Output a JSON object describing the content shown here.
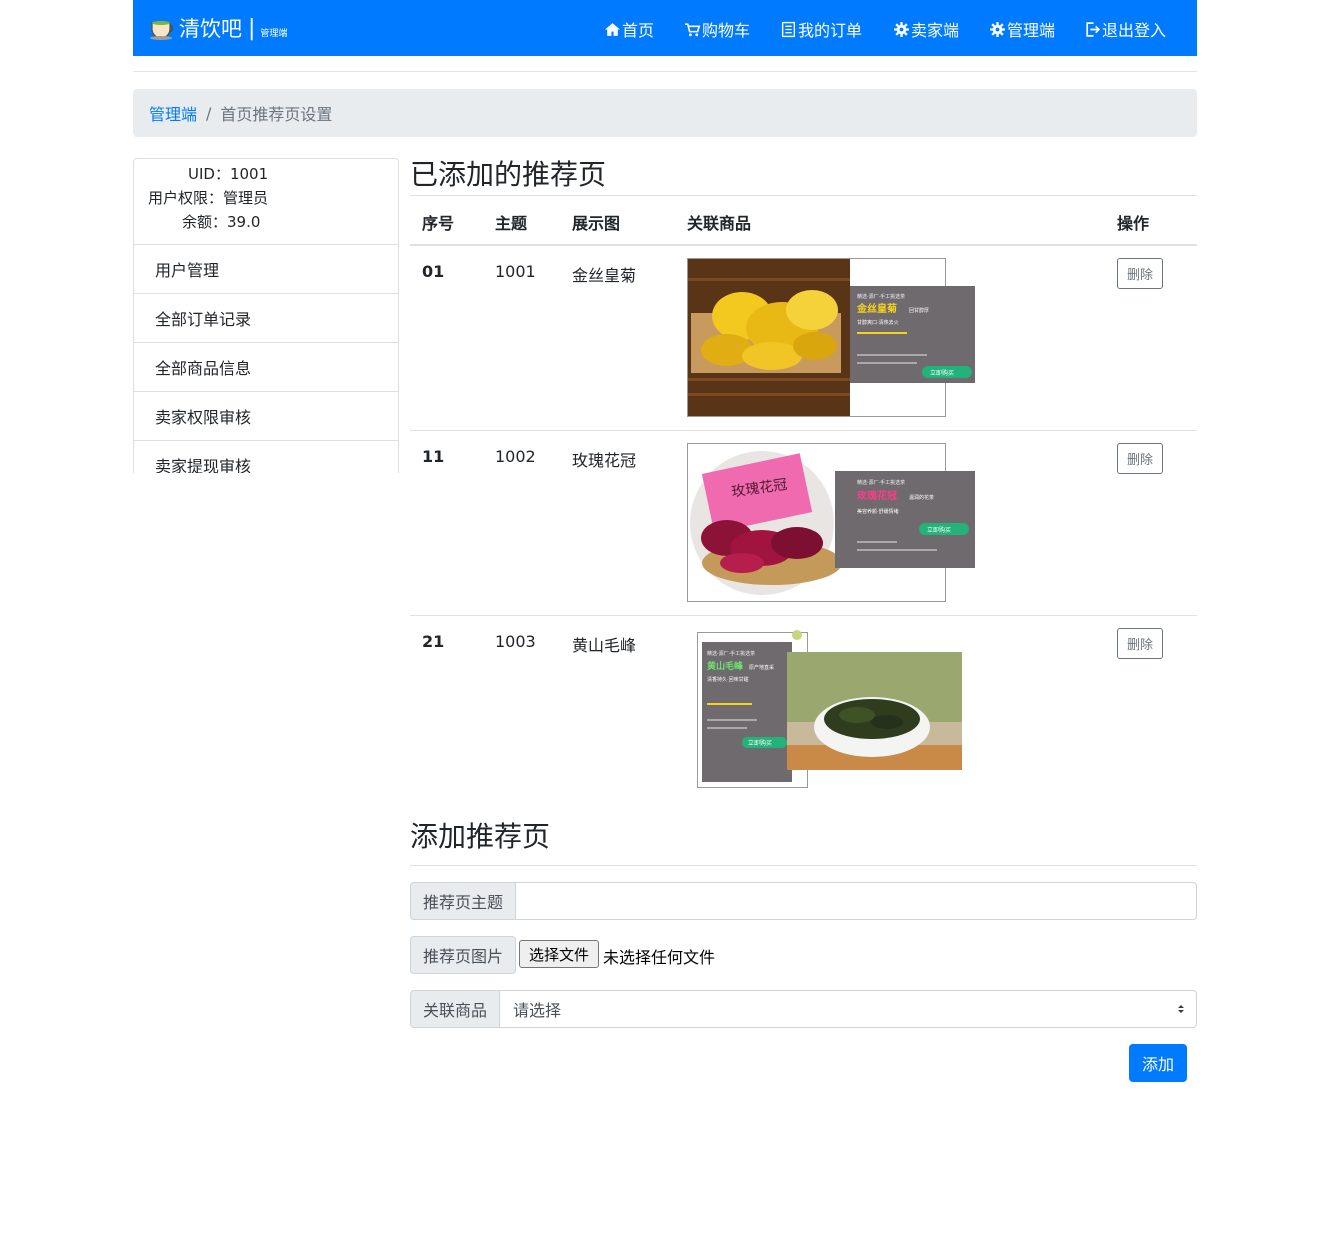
{
  "navbar": {
    "brand": "清饮吧",
    "brand_sep": "|",
    "brand_sub": "管理端",
    "items": [
      {
        "label": "首页",
        "icon": "home-icon"
      },
      {
        "label": "购物车",
        "icon": "cart-icon"
      },
      {
        "label": "我的订单",
        "icon": "list-icon"
      },
      {
        "label": "卖家端",
        "icon": "gear-icon"
      },
      {
        "label": "管理端",
        "icon": "gear-icon"
      },
      {
        "label": "退出登入",
        "icon": "logout-icon"
      }
    ]
  },
  "breadcrumb": {
    "root": "管理端",
    "sep": "/",
    "current": "首页推荐页设置"
  },
  "sidebar": {
    "uid": "UID：1001",
    "role": "用户权限：管理员",
    "balance": "余额：39.0",
    "menu": [
      "用户管理",
      "全部订单记录",
      "全部商品信息",
      "卖家权限审核",
      "卖家提现审核"
    ]
  },
  "list": {
    "title": "已添加的推荐页",
    "headers": [
      "序号",
      "主题",
      "展示图",
      "关联商品",
      "操作"
    ],
    "rows": [
      {
        "index": "01",
        "theme": "1001",
        "product": "金丝皇菊",
        "delete": "删除",
        "banner": {
          "line1": "精选·源厂·手工挑选茶",
          "name": "金丝皇菊",
          "tag": "回甘醇厚",
          "desc": "甘醇爽口·清热去火",
          "btn": "立即购买"
        }
      },
      {
        "index": "11",
        "theme": "1002",
        "product": "玫瑰花冠",
        "delete": "删除",
        "banner": {
          "line1": "精选·源厂·手工挑选茶",
          "name": "玫瑰花冠",
          "tag": "温润的花茶",
          "desc": "美容养颜·舒缓情绪",
          "btn": "立即购买",
          "pkg": "玫瑰花冠"
        }
      },
      {
        "index": "21",
        "theme": "1003",
        "product": "黄山毛峰",
        "delete": "删除",
        "banner": {
          "line1": "精选·源厂·手工挑选茶",
          "name": "黄山毛峰",
          "tag": "原产地直采",
          "desc": "清香持久·回味甘甜",
          "btn": "立即购买"
        }
      }
    ]
  },
  "form": {
    "title": "添加推荐页",
    "theme_label": "推荐页主题",
    "theme_value": "",
    "image_label": "推荐页图片",
    "file_button": "选择文件",
    "file_status": "未选择任何文件",
    "product_label": "关联商品",
    "product_selected": "请选择",
    "submit": "添加"
  }
}
